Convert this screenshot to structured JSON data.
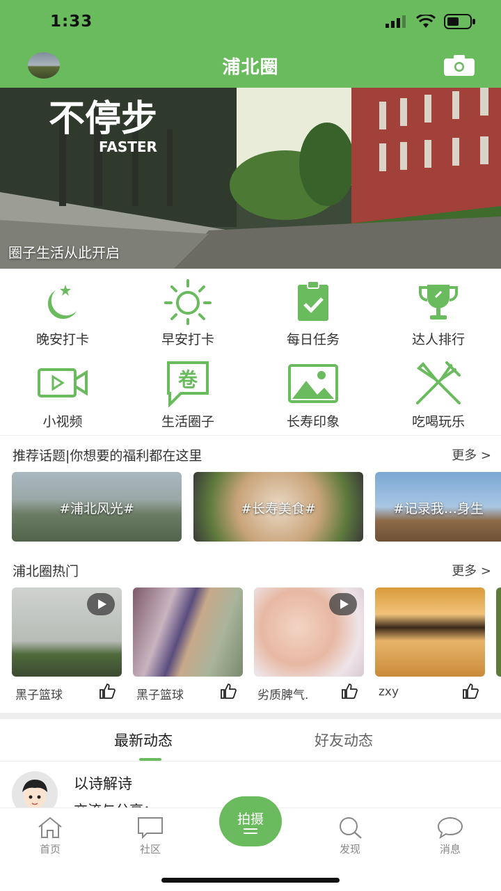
{
  "status": {
    "time": "1:33"
  },
  "header": {
    "title": "浦北圈"
  },
  "banner": {
    "caption": "圈子生活从此开启",
    "logo_text_cn": "不停步",
    "logo_text_en": "FASTER"
  },
  "grid": [
    {
      "label": "晚安打卡",
      "icon": "moon-star-icon"
    },
    {
      "label": "早安打卡",
      "icon": "sun-icon"
    },
    {
      "label": "每日任务",
      "icon": "clipboard-check-icon"
    },
    {
      "label": "达人排行",
      "icon": "trophy-icon"
    },
    {
      "label": "小视频",
      "icon": "video-camera-icon"
    },
    {
      "label": "生活圈子",
      "icon": "juan-chat-icon"
    },
    {
      "label": "长寿印象",
      "icon": "image-icon"
    },
    {
      "label": "吃喝玩乐",
      "icon": "fork-knife-icon"
    }
  ],
  "topics": {
    "title": "推荐话题|你想要的福利都在这里",
    "more": "更多 >",
    "items": [
      "#浦北风光#",
      "#长寿美食#",
      "#记录我…身生"
    ]
  },
  "hot": {
    "title": "浦北圈热门",
    "more": "更多 >",
    "items": [
      {
        "name": "黑子篮球",
        "video": true
      },
      {
        "name": "黑子篮球",
        "video": false
      },
      {
        "name": "劣质脾气.",
        "video": true
      },
      {
        "name": "zxy",
        "video": false
      }
    ]
  },
  "tabs": [
    "最新动态",
    "好友动态"
  ],
  "feed": {
    "name": "以诗解诗",
    "text": "交流与分享："
  },
  "tabbar": {
    "home": "首页",
    "community": "社区",
    "shoot": "拍摄",
    "discover": "发现",
    "messages": "消息"
  },
  "colors": {
    "accent": "#6aba5e"
  }
}
